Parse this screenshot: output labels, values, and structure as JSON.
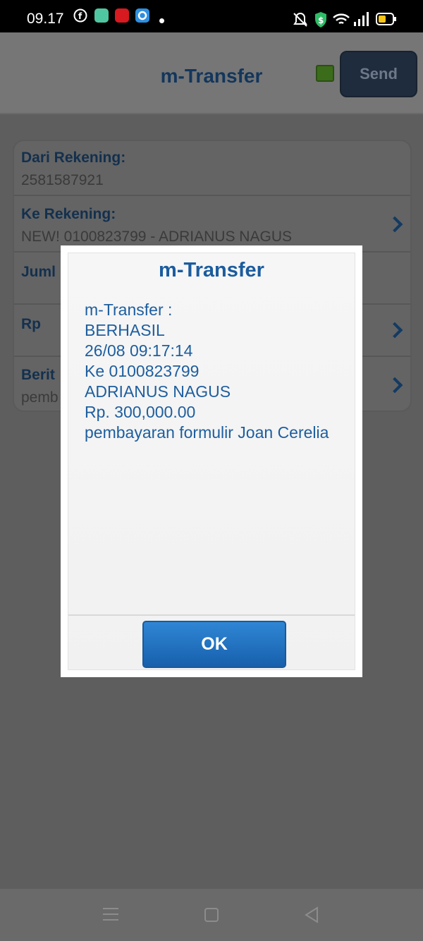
{
  "status_bar": {
    "time": "09.17",
    "notification_icons": [
      "facebook-icon",
      "calculator-app-icon",
      "news-app-icon",
      "chat-app-icon"
    ],
    "system_icons": [
      "mute-icon",
      "vpn-shield-icon",
      "wifi-icon",
      "signal-icon",
      "battery-icon"
    ]
  },
  "header": {
    "title": "m-Transfer",
    "send_label": "Send"
  },
  "form": {
    "from_label": "Dari Rekening:",
    "from_value": "2581587921",
    "to_label": "Ke Rekening:",
    "to_value": "NEW! 0100823799 - ADRIANUS NAGUS",
    "amount_label": "Juml",
    "rp_label": "Rp",
    "news_label": "Berit",
    "news_value": "pemb"
  },
  "dialog": {
    "title": "m-Transfer",
    "lines": [
      "m-Transfer :",
      "BERHASIL",
      "26/08 09:17:14",
      "Ke 0100823799",
      "ADRIANUS NAGUS",
      "Rp. 300,000.00",
      "pembayaran formulir Joan Cerelia"
    ],
    "ok_label": "OK"
  },
  "colors": {
    "accent_blue": "#1b5c9e",
    "ok_button": "#1f6fbf"
  }
}
